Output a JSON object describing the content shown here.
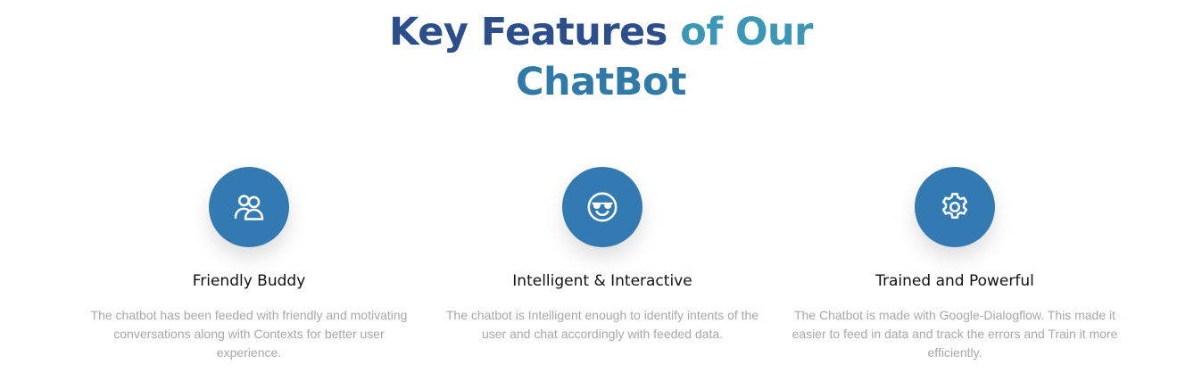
{
  "heading": {
    "part1": "Key Features",
    "part2": "of Our",
    "part3": "ChatBot"
  },
  "colors": {
    "heading_dark": "#2c4e8a",
    "heading_teal": "#3a97b5",
    "icon_circle": "#337ab3",
    "title_text": "#111111",
    "desc_text": "#a8a8a8"
  },
  "features": [
    {
      "icon": "users-icon",
      "title": "Friendly Buddy",
      "description": "The chatbot has been feeded with friendly and motivating conversations along with Contexts for better user experience."
    },
    {
      "icon": "smiley-sunglasses-icon",
      "title": "Intelligent & Interactive",
      "description": "The chatbot is Intelligent enough to identify intents of the user and chat accordingly with feeded data."
    },
    {
      "icon": "gear-icon",
      "title": "Trained and Powerful",
      "description": "The Chatbot is made with Google-Dialogflow. This made it easier to feed in data and track the errors and Train it more efficiently."
    }
  ]
}
